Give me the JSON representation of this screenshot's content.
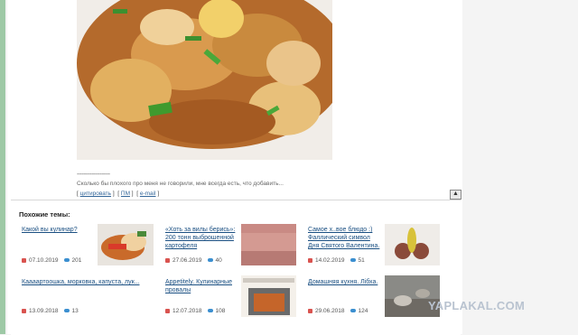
{
  "post": {
    "separator": "--------------------",
    "signature": "Сколько бы плохого про меня не говорили, мне всегда есть, что добавить...",
    "actions": [
      "цитировать",
      "ПМ",
      "e-mail"
    ],
    "up_icon": "arrow-up-icon"
  },
  "similar": {
    "title": "Похожие темы:",
    "items": [
      {
        "title": "Какой вы кулинар?",
        "date": "07.10.2019",
        "comments": "201"
      },
      {
        "title": "«Хоть за вилы берись»: 200 тонн выброшенной картофеля",
        "date": "27.06.2019",
        "comments": "40"
      },
      {
        "title": "Самое х..вое блюдо :) Фаллический символ Дня Святого Валентина.",
        "date": "14.02.2019",
        "comments": "51"
      },
      {
        "title": "Каааартоошка, морковка, капуста, лук...",
        "date": "13.09.2018",
        "comments": "13"
      },
      {
        "title": "Appetitely. Кулинарные провалы",
        "date": "12.07.2018",
        "comments": "108"
      },
      {
        "title": "Домашняя кухня. Лібха.",
        "date": "29.06.2018",
        "comments": "124"
      }
    ]
  },
  "watermark": "YAPLAKAL.COM",
  "colors": {
    "link": "#1a4f82",
    "accent_left": "#9ec9a6"
  }
}
